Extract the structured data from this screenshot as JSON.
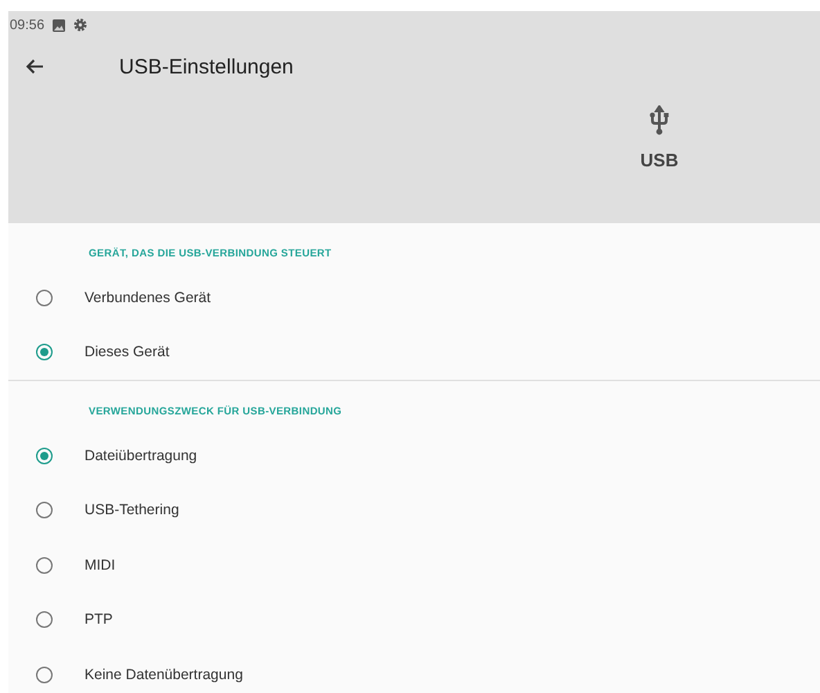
{
  "status_bar": {
    "time": "09:56"
  },
  "toolbar": {
    "title": "USB-Einstellungen"
  },
  "header": {
    "label": "USB"
  },
  "sections": [
    {
      "title": "GERÄT, DAS DIE USB-VERBINDUNG STEUERT",
      "options": [
        {
          "label": "Verbundenes Gerät",
          "selected": false
        },
        {
          "label": "Dieses Gerät",
          "selected": true
        }
      ]
    },
    {
      "title": "VERWENDUNGSZWECK FÜR USB-VERBINDUNG",
      "options": [
        {
          "label": "Dateiübertragung",
          "selected": true
        },
        {
          "label": "USB-Tethering",
          "selected": false
        },
        {
          "label": "MIDI",
          "selected": false
        },
        {
          "label": "PTP",
          "selected": false
        },
        {
          "label": "Keine Datenübertragung",
          "selected": false
        }
      ]
    }
  ]
}
